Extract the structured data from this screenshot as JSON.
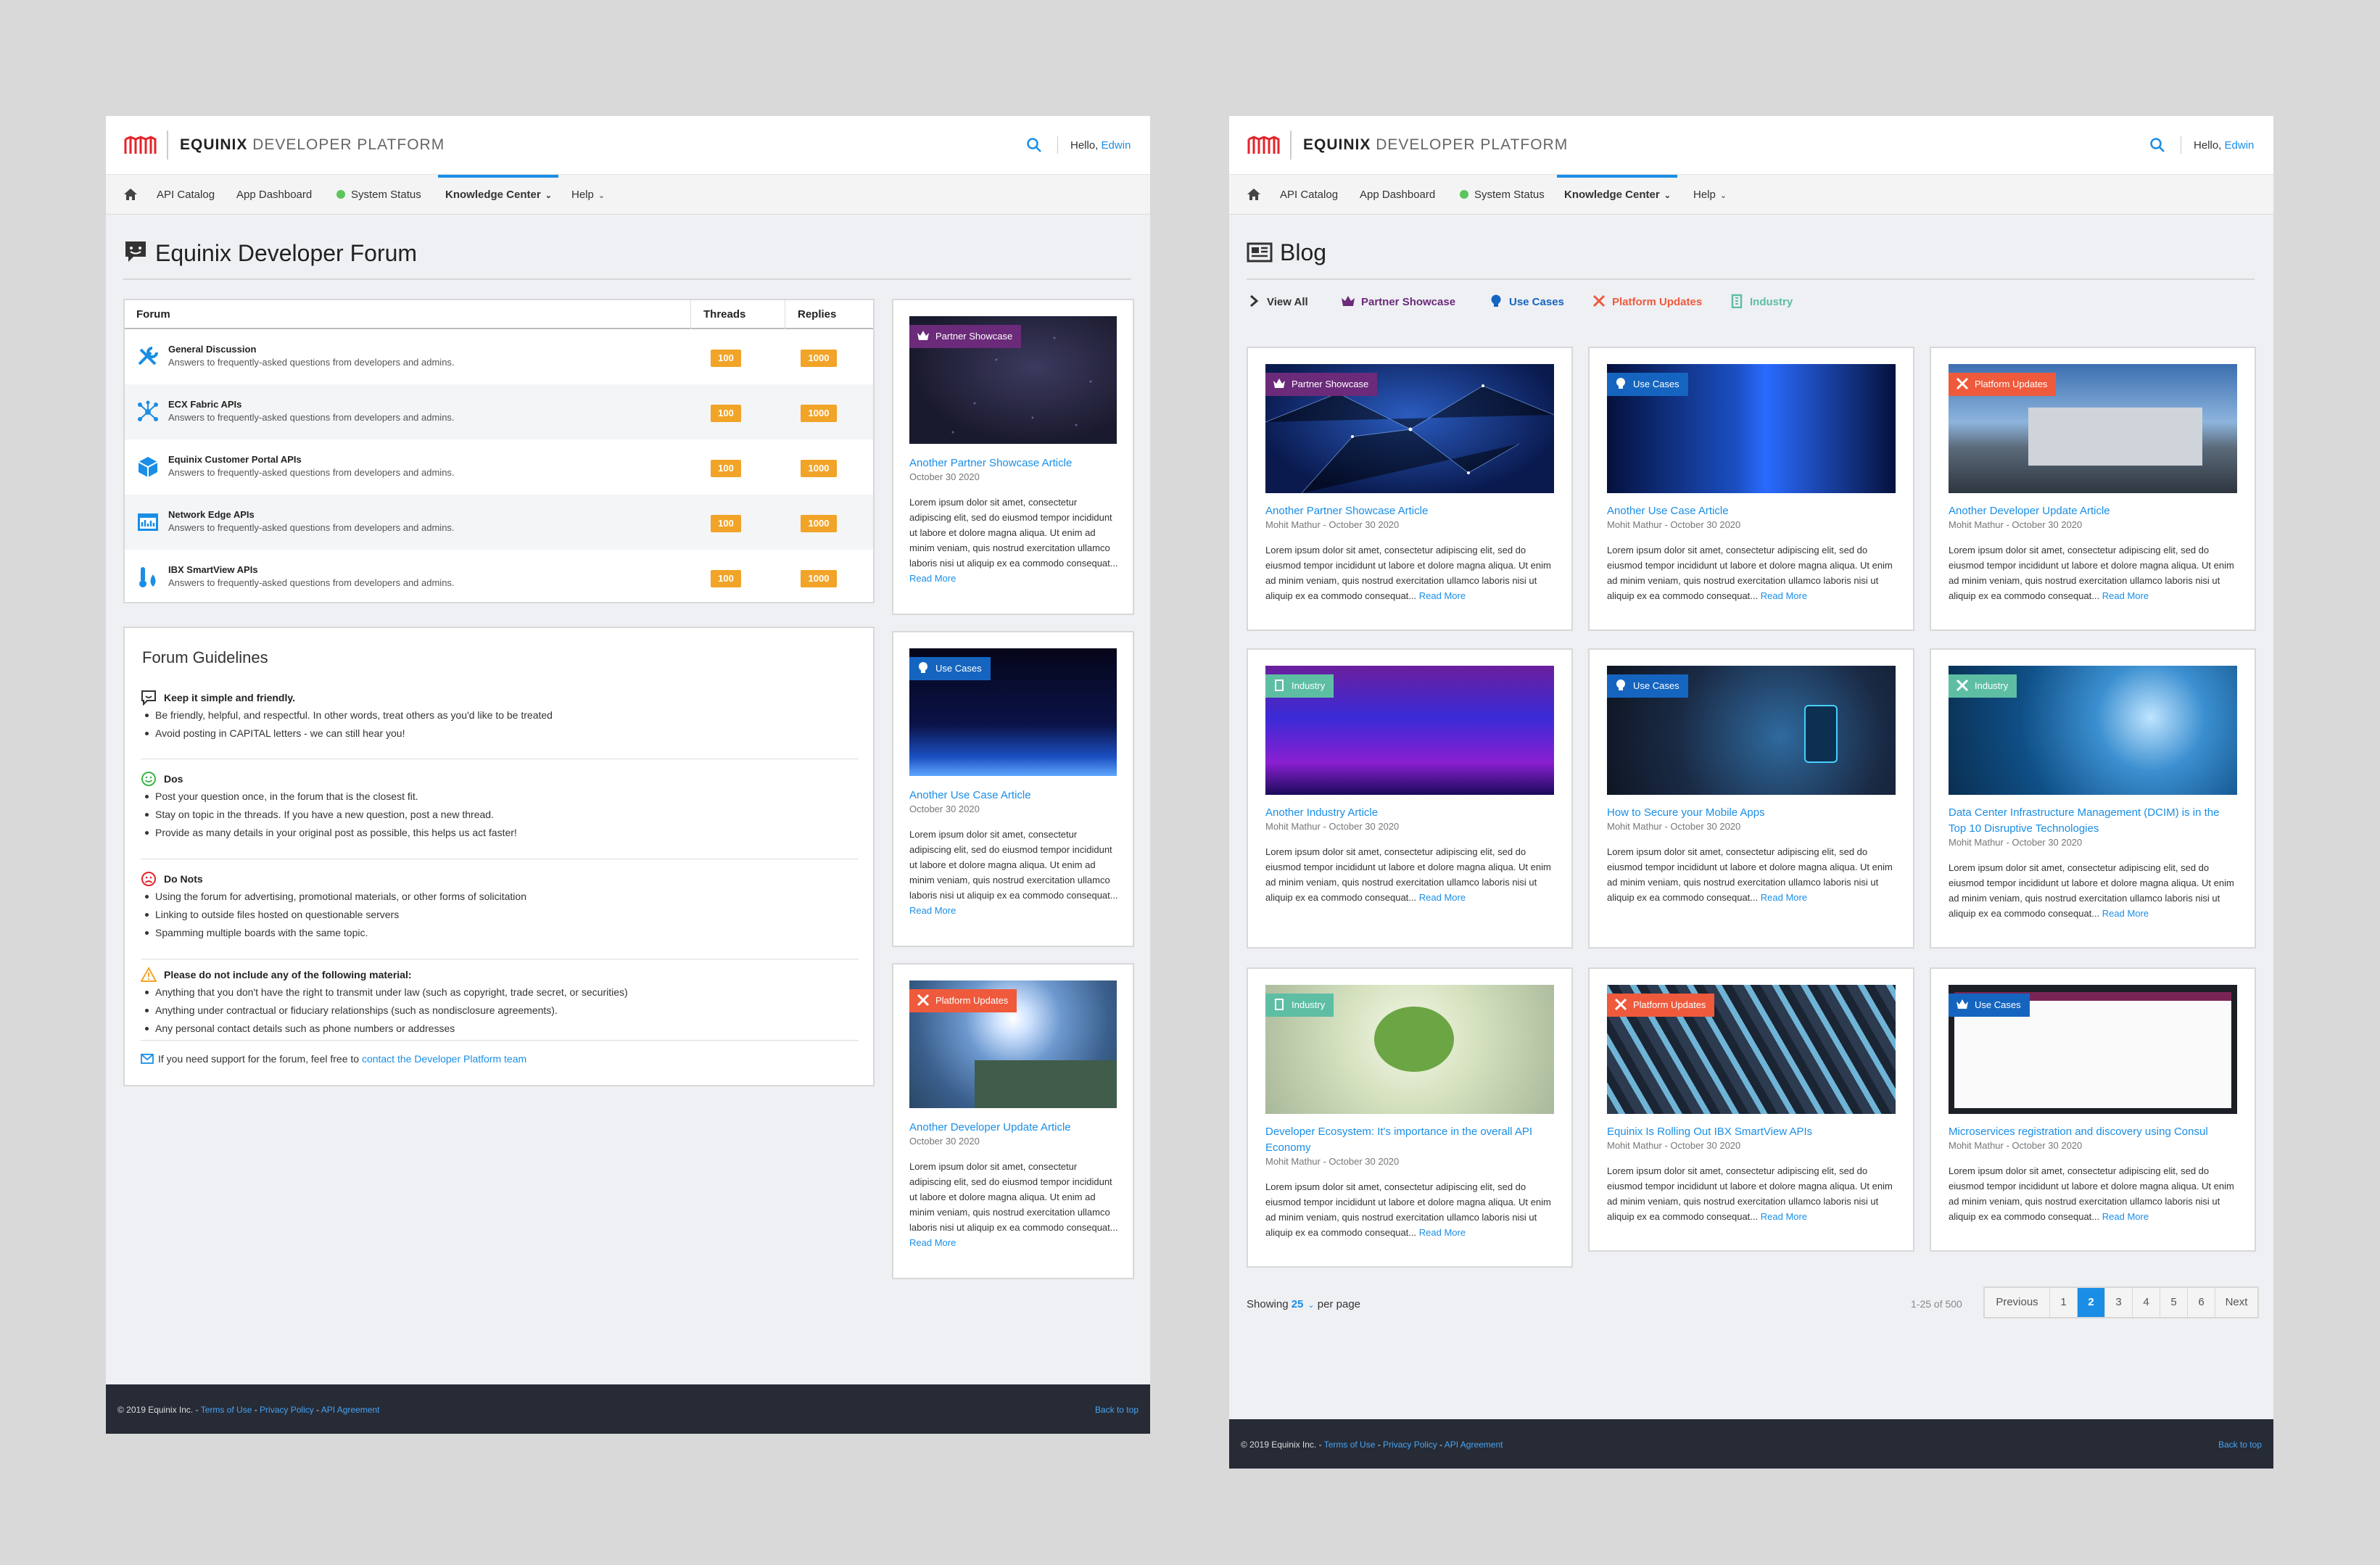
{
  "header": {
    "brand_strong": "EQUINIX",
    "brand_light": " DEVELOPER PLATFORM",
    "hello": "Hello, ",
    "user": "Edwin"
  },
  "nav": {
    "api_catalog": "API Catalog",
    "app_dashboard": "App Dashboard",
    "system_status": "System Status",
    "knowledge_center": "Knowledge Center",
    "help": "Help"
  },
  "forum": {
    "title": "Equinix Developer Forum",
    "columns": [
      "Forum",
      "Threads",
      "Replies"
    ],
    "rows": [
      {
        "name": "General Discussion",
        "desc": "Answers to frequently-asked questions from developers and admins.",
        "threads": "100",
        "replies": "1000",
        "icon": "tools-icon"
      },
      {
        "name": "ECX Fabric APIs",
        "desc": "Answers to frequently-asked questions from developers and admins.",
        "threads": "100",
        "replies": "1000",
        "icon": "network-nodes-icon"
      },
      {
        "name": "Equinix Customer Portal APIs",
        "desc": "Answers to frequently-asked questions from developers and admins.",
        "threads": "100",
        "replies": "1000",
        "icon": "cube-icon"
      },
      {
        "name": "Network Edge APIs",
        "desc": "Answers to frequently-asked questions from developers and admins.",
        "threads": "100",
        "replies": "1000",
        "icon": "chart-window-icon"
      },
      {
        "name": "IBX SmartView APIs",
        "desc": "Answers to frequently-asked questions from developers and admins.",
        "threads": "100",
        "replies": "1000",
        "icon": "thermometer-drop-icon"
      }
    ],
    "guidelines": {
      "title": "Forum Guidelines",
      "s1_title": "Keep it simple and friendly.",
      "s1_items": [
        "Be friendly, helpful, and respectful. In other words, treat others as you'd like to be treated",
        "Avoid posting in CAPITAL letters - we can still hear you!"
      ],
      "s2_title": "Dos",
      "s2_items": [
        "Post your question once, in the forum that is the closest fit.",
        "Stay on topic in the threads. If you have a new question, post a new thread.",
        "Provide as many details in your original post as possible, this helps us act faster!"
      ],
      "s3_title": "Do Nots",
      "s3_items": [
        "Using the forum for advertising, promotional materials, or other forms of solicitation",
        "Linking to outside files hosted on questionable servers",
        "Spamming multiple boards with the same topic."
      ],
      "s4_title": "Please do not include any of the following material:",
      "s4_items": [
        "Anything that you don't have the right to transmit under law (such as copyright, trade secret, or securities)",
        "Anything under contractual or fiduciary relationships (such as nondisclosure agreements).",
        "Any personal contact details such as phone numbers or addresses"
      ],
      "contact_text": "If you need support for the forum, feel free to ",
      "contact_link": "contact the Developer Platform team"
    },
    "side_cards": [
      {
        "tag": "Partner Showcase",
        "title": "Another Partner Showcase Article",
        "date": "October 30 2020",
        "body": "Lorem ipsum dolor sit amet, consectetur adipiscing elit, sed do eiusmod tempor incididunt ut labore et dolore magna aliqua. Ut enim ad minim veniam, quis nostrud exercitation ullamco laboris nisi ut aliquip ex ea commodo consequat...",
        "read_more": "Read More"
      },
      {
        "tag": "Use Cases",
        "title": "Another Use Case Article",
        "date": "October 30 2020",
        "body": "Lorem ipsum dolor sit amet, consectetur adipiscing elit, sed do eiusmod tempor incididunt ut labore et dolore magna aliqua. Ut enim ad minim veniam, quis nostrud exercitation ullamco laboris nisi ut aliquip ex ea commodo consequat...",
        "read_more": "Read More"
      },
      {
        "tag": "Platform Updates",
        "title": "Another Developer Update Article",
        "date": "October 30 2020",
        "body": "Lorem ipsum dolor sit amet, consectetur adipiscing elit, sed do eiusmod tempor incididunt ut labore et dolore magna aliqua. Ut enim ad minim veniam, quis nostrud exercitation ullamco laboris nisi ut aliquip ex ea commodo consequat...",
        "read_more": "Read More"
      }
    ]
  },
  "blog": {
    "title": "Blog",
    "filters": {
      "view_all": "View All",
      "partner": "Partner Showcase",
      "use_cases": "Use Cases",
      "platform": "Platform Updates",
      "industry": "Industry"
    },
    "cards": [
      {
        "tag": "Partner Showcase",
        "title": "Another Partner Showcase Article",
        "meta": "Mohit Mathur - October 30 2020"
      },
      {
        "tag": "Use Cases",
        "title": "Another Use Case Article",
        "meta": "Mohit Mathur - October 30 2020"
      },
      {
        "tag": "Platform Updates",
        "title": "Another Developer Update Article",
        "meta": "Mohit Mathur - October 30 2020"
      },
      {
        "tag": "Industry",
        "title": "Another Industry Article",
        "meta": "Mohit Mathur - October 30 2020"
      },
      {
        "tag": "Use Cases",
        "title": "How to Secure your Mobile Apps",
        "meta": "Mohit Mathur - October 30 2020"
      },
      {
        "tag": "Industry",
        "title": "Data Center Infrastructure Management (DCIM) is in the Top 10 Disruptive Technologies",
        "meta": "Mohit Mathur - October 30 2020"
      },
      {
        "tag": "Industry",
        "title": "Developer Ecosystem: It's importance in the overall API Economy",
        "meta": "Mohit Mathur - October 30 2020"
      },
      {
        "tag": "Platform Updates",
        "title": "Equinix Is Rolling Out IBX SmartView APIs",
        "meta": "Mohit Mathur - October 30 2020"
      },
      {
        "tag": "Use Cases",
        "title": "Microservices registration and discovery using Consul",
        "meta": "Mohit Mathur - October 30 2020"
      }
    ],
    "card_body": "Lorem ipsum dolor sit amet, consectetur adipiscing elit, sed do eiusmod tempor incididunt ut labore et dolore magna aliqua. Ut enim ad minim veniam, quis nostrud exercitation ullamco laboris nisi ut aliquip ex ea commodo consequat...",
    "read_more": "Read More",
    "pagination": {
      "showing": "Showing ",
      "per_page_value": "25",
      "per_page_suffix": " per page",
      "range": "1-25 of 500",
      "previous": "Previous",
      "pages": [
        "1",
        "2",
        "3",
        "4",
        "5",
        "6"
      ],
      "current": "2",
      "next": "Next"
    }
  },
  "footer": {
    "copyright": "© 2019 Equinix Inc. - ",
    "terms": "Terms of Use",
    "privacy": "Privacy Policy",
    "api_agreement": "API Agreement",
    "sep": " - ",
    "back_to_top": "Back to top"
  },
  "colors": {
    "accent": "#1a8ee6",
    "badge": "#f1a428",
    "partner": "#6b2a7a",
    "use_cases": "#1565c0",
    "platform": "#ef5a3c",
    "industry": "#5dbea3",
    "footer": "#262b36"
  }
}
